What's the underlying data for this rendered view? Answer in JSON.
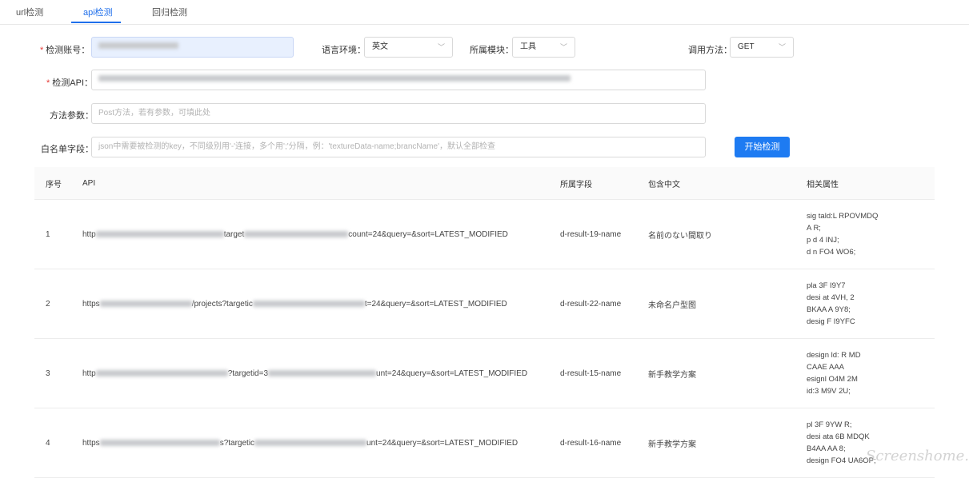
{
  "tabs": [
    "url检测",
    "api检测",
    "回归检测"
  ],
  "form": {
    "account_label": "检测账号：",
    "lang_label": "语言环境：",
    "lang_value": "英文",
    "module_label": "所属模块：",
    "module_value": "工具",
    "method_label": "调用方法：",
    "method_value": "GET",
    "api_label": "检测API：",
    "params_label": "方法参数：",
    "params_placeholder": "Post方法，若有参数，可填此处",
    "whitelist_label": "白名单字段：",
    "whitelist_placeholder": "json中需要被检测的key，不同级别用'-'连接，多个用';'分隔，例：'textureData-name;brancName'，默认全部检查",
    "start_button": "开始检测"
  },
  "table": {
    "headers": [
      "序号",
      "API",
      "所属字段",
      "包含中文",
      "相关属性"
    ],
    "rows": [
      {
        "idx": "1",
        "api_prefix": "http",
        "api_mid": "target",
        "api_suffix": "count=24&query=&sort=LATEST_MODIFIED",
        "field": "d-result-19-name",
        "chinese": "名前のない間取り",
        "attrs": [
          "sig      tald:L      RPOVMDQ",
          "  A          R;",
          "p      d     4          INJ;",
          "d       n    FO4       WO6;"
        ]
      },
      {
        "idx": "2",
        "api_prefix": "https",
        "api_mid": "/projects?targetic",
        "api_suffix": "t=24&query=&sort=LATEST_MODIFIED",
        "field": "d-result-22-name",
        "chinese": "未命名户型图",
        "attrs": [
          "pla      3F      I9Y7",
          "desi      at      4VH,        2",
          "BKAA        A      9Y8;",
          "desig      F      I9YFC"
        ]
      },
      {
        "idx": "3",
        "api_prefix": "http",
        "api_mid": "?targetid=3",
        "api_suffix": "unt=24&query=&sort=LATEST_MODIFIED",
        "field": "d-result-15-name",
        "chinese": "新手教学方案",
        "attrs": [
          "design      ld:      R      MD",
          "  CAAE      AAA",
          "esignl      O4M      2M",
          "  id:3      M9V      2U;"
        ]
      },
      {
        "idx": "4",
        "api_prefix": "https",
        "api_mid": "s?targetic",
        "api_suffix": "unt=24&query=&sort=LATEST_MODIFIED",
        "field": "d-result-16-name",
        "chinese": "新手教学方案",
        "attrs": [
          "pl      3F      9YW      R;",
          "desi      ata      6B      MDQK",
          "B4AA      AA      8;",
          "design      FO4      UA6OP;"
        ]
      }
    ]
  },
  "watermark": "Screenshome.com"
}
